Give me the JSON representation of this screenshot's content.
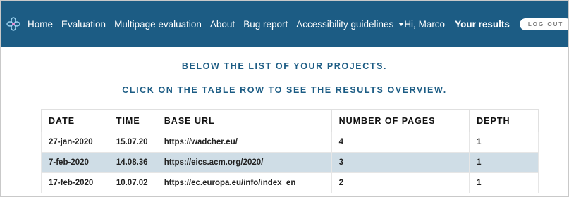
{
  "nav": {
    "links": [
      "Home",
      "Evaluation",
      "Multipage evaluation",
      "About",
      "Bug report"
    ],
    "dropdown_label": "Accessibility guidelines",
    "greeting": "Hi, Marco",
    "results_label": "Your results",
    "logout_label": "LOG OUT"
  },
  "main": {
    "heading_1": "BELOW THE LIST OF YOUR PROJECTS.",
    "heading_2": "CLICK ON THE TABLE ROW TO SEE THE RESULTS OVERVIEW."
  },
  "table": {
    "headers": [
      "DATE",
      "TIME",
      "BASE URL",
      "NUMBER OF PAGES",
      "DEPTH"
    ],
    "rows": [
      [
        "27-jan-2020",
        "15.07.20",
        "https://wadcher.eu/",
        "4",
        "1"
      ],
      [
        "7-feb-2020",
        "14.08.36",
        "https://eics.acm.org/2020/",
        "3",
        "1"
      ],
      [
        "17-feb-2020",
        "10.07.02",
        "https://ec.europa.eu/info/index_en",
        "2",
        "1"
      ]
    ],
    "selected_row": 1
  },
  "colors": {
    "navbar": "#1c5c84",
    "heading": "#1c5c84",
    "selected_row": "#cfdde6"
  },
  "icons": {
    "logo": "flower-logo-icon",
    "dropdown": "caret-down-icon"
  }
}
